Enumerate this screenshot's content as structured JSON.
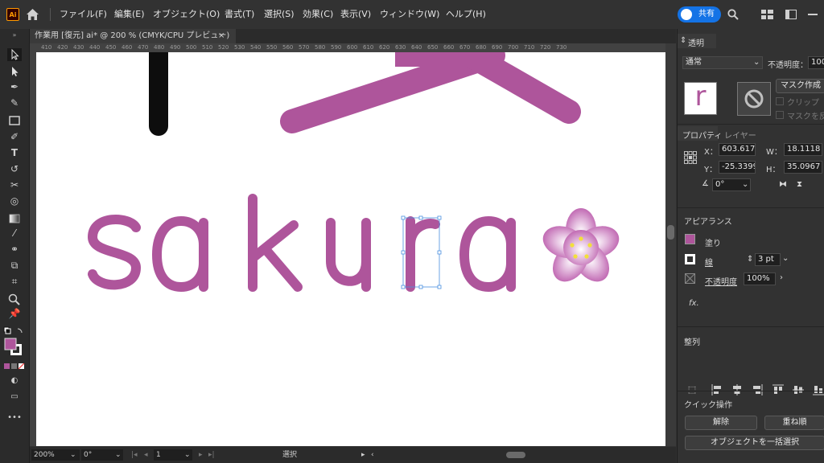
{
  "menubar": {
    "logo": "Ai",
    "items": [
      "ファイル(F)",
      "編集(E)",
      "オブジェクト(O)",
      "書式(T)",
      "選択(S)",
      "効果(C)",
      "表示(V)",
      "ウィンドウ(W)",
      "ヘルプ(H)"
    ],
    "share_label": "共有"
  },
  "document": {
    "tab_title": "作業用 [復元] ai* @ 200 % (CMYK/CPU プレビュー)",
    "close_glyph": "×"
  },
  "ruler": {
    "ticks": [
      "410",
      "420",
      "430",
      "440",
      "450",
      "460",
      "470",
      "480",
      "490",
      "500",
      "510",
      "520",
      "530",
      "540",
      "550",
      "560",
      "570",
      "580",
      "590",
      "600",
      "610",
      "620",
      "630",
      "640",
      "650",
      "660",
      "670",
      "680",
      "690",
      "700",
      "710",
      "720",
      "730"
    ]
  },
  "artwork": {
    "text": "sakura",
    "text_color": "#ae559b",
    "stroke_black": "#0d0d0d",
    "flower_outer": "#c16ab3",
    "flower_center": "#ffffff",
    "stamen_color": "#f2e03a"
  },
  "statusbar": {
    "zoom": "200%",
    "rotation": "0°",
    "artboard": "1",
    "mode": "選択"
  },
  "panel": {
    "transparency_tab": "透明",
    "blend_mode": "通常",
    "opacity_label": "不透明度：",
    "opacity_value": "100",
    "make_mask_label": "マスク作成",
    "clip_label": "クリップ",
    "invert_label": "マスクを反",
    "thumb_letter": "r",
    "tabs": [
      "プロパティ",
      "レイヤー"
    ],
    "transform": {
      "x_label": "X：",
      "x_value": "603.617",
      "y_label": "Y：",
      "y_value": "-25.3399",
      "w_label": "W：",
      "w_value": "18.1118",
      "h_label": "H：",
      "h_value": "35.0967",
      "angle_value": "0°"
    },
    "appearance": {
      "title": "アピアランス",
      "fill_label": "塗り",
      "stroke_label": "線",
      "stroke_value": "3 pt",
      "opacity_label": "不透明度",
      "opacity_value": "100%",
      "fx_label": "fx."
    },
    "align_title": "整列",
    "quick_title": "クイック操作",
    "release_label": "解除",
    "arrange_label": "重ね順",
    "select_all_label": "オブジェクトを一括選択"
  },
  "colors": {
    "fill_swatch": "#ae559b",
    "accent_blue": "#1473e6",
    "selection_blue": "#4a8fe0"
  }
}
